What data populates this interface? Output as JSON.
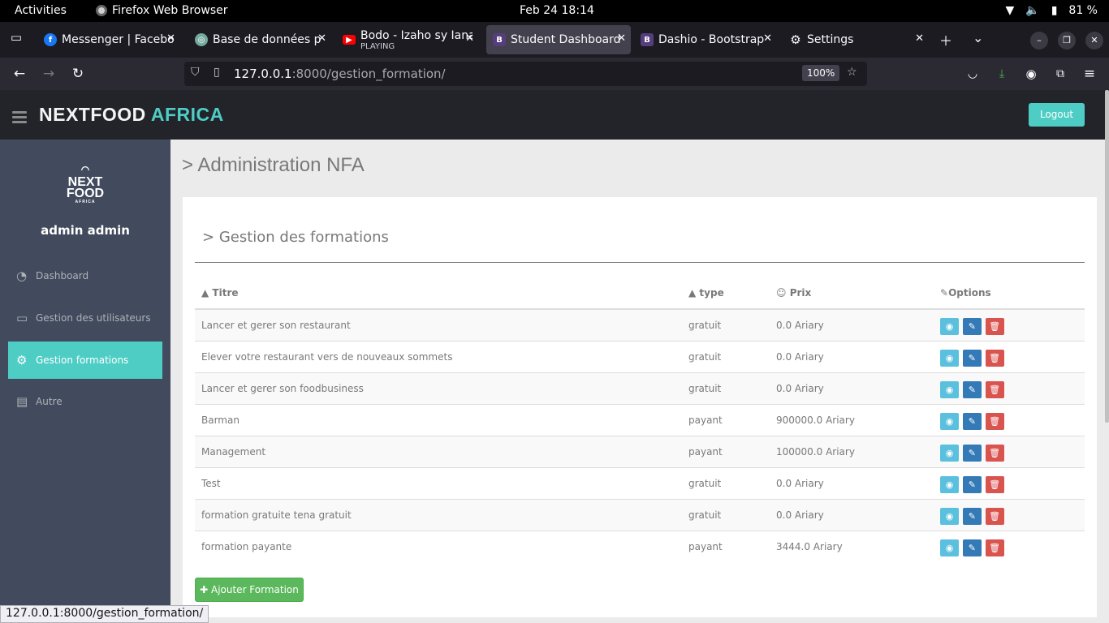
{
  "gnome": {
    "activities": "Activities",
    "app_name": "Firefox Web Browser",
    "clock": "Feb 24  18:14",
    "battery": "81 %"
  },
  "tabs": [
    {
      "title": "Messenger | Facebook",
      "favicon": "facebook-icon",
      "color": "#1877f2"
    },
    {
      "title": "Base de données p",
      "favicon": "chatgpt-icon",
      "color": "#74aa9c"
    },
    {
      "title": "Bodo - Izaho sy Iana",
      "subtitle": "PLAYING",
      "favicon": "youtube-icon",
      "color": "#ff0000"
    },
    {
      "title": "Student Dashboard",
      "favicon": "bootstrap-icon",
      "color": "#563d7c"
    },
    {
      "title": "Dashio - Bootstrap",
      "favicon": "bootstrap-icon",
      "color": "#563d7c"
    },
    {
      "title": "Settings",
      "favicon": "gear-icon",
      "color": "#fbfbfe"
    }
  ],
  "urlbar": {
    "host": "127.0.0.1",
    "rest": ":8000/gestion_formation/",
    "zoom": "100%"
  },
  "header": {
    "brand_main": "NEXTFOOD",
    "brand_accent": "AFRICA",
    "logout": "Logout"
  },
  "sidebar": {
    "logo_top": "NEXT",
    "logo_bottom": "FOOD",
    "logo_small": "AFRICA",
    "username": "admin admin",
    "items": [
      {
        "label": "Dashboard",
        "icon": "dashboard-icon"
      },
      {
        "label": "Gestion des utilisateurs",
        "icon": "desktop-icon"
      },
      {
        "label": "Gestion formations",
        "icon": "gears-icon",
        "active": true
      },
      {
        "label": "Autre",
        "icon": "book-icon"
      }
    ]
  },
  "main": {
    "page_title": "Administration NFA",
    "panel_title": "Gestion des formations",
    "columns": [
      "Titre",
      "type",
      "Prix",
      "Options"
    ],
    "rows": [
      {
        "titre": "Lancer et gerer son restaurant",
        "type": "gratuit",
        "prix": "0.0 Ariary"
      },
      {
        "titre": "Elever votre restaurant vers de nouveaux sommets",
        "type": "gratuit",
        "prix": "0.0 Ariary"
      },
      {
        "titre": "Lancer et gerer son foodbusiness",
        "type": "gratuit",
        "prix": "0.0 Ariary"
      },
      {
        "titre": "Barman",
        "type": "payant",
        "prix": "900000.0 Ariary"
      },
      {
        "titre": "Management",
        "type": "payant",
        "prix": "100000.0 Ariary"
      },
      {
        "titre": "Test",
        "type": "gratuit",
        "prix": "0.0 Ariary"
      },
      {
        "titre": "formation gratuite tena gratuit",
        "type": "gratuit",
        "prix": "0.0 Ariary"
      },
      {
        "titre": "formation payante",
        "type": "payant",
        "prix": "3444.0 Ariary"
      }
    ],
    "add_button": "Ajouter Formation"
  },
  "status_bar": "127.0.0.1:8000/gestion_formation/",
  "colors": {
    "accent": "#4ecdc4",
    "sidebar": "#424a5d",
    "header": "#22242a"
  }
}
